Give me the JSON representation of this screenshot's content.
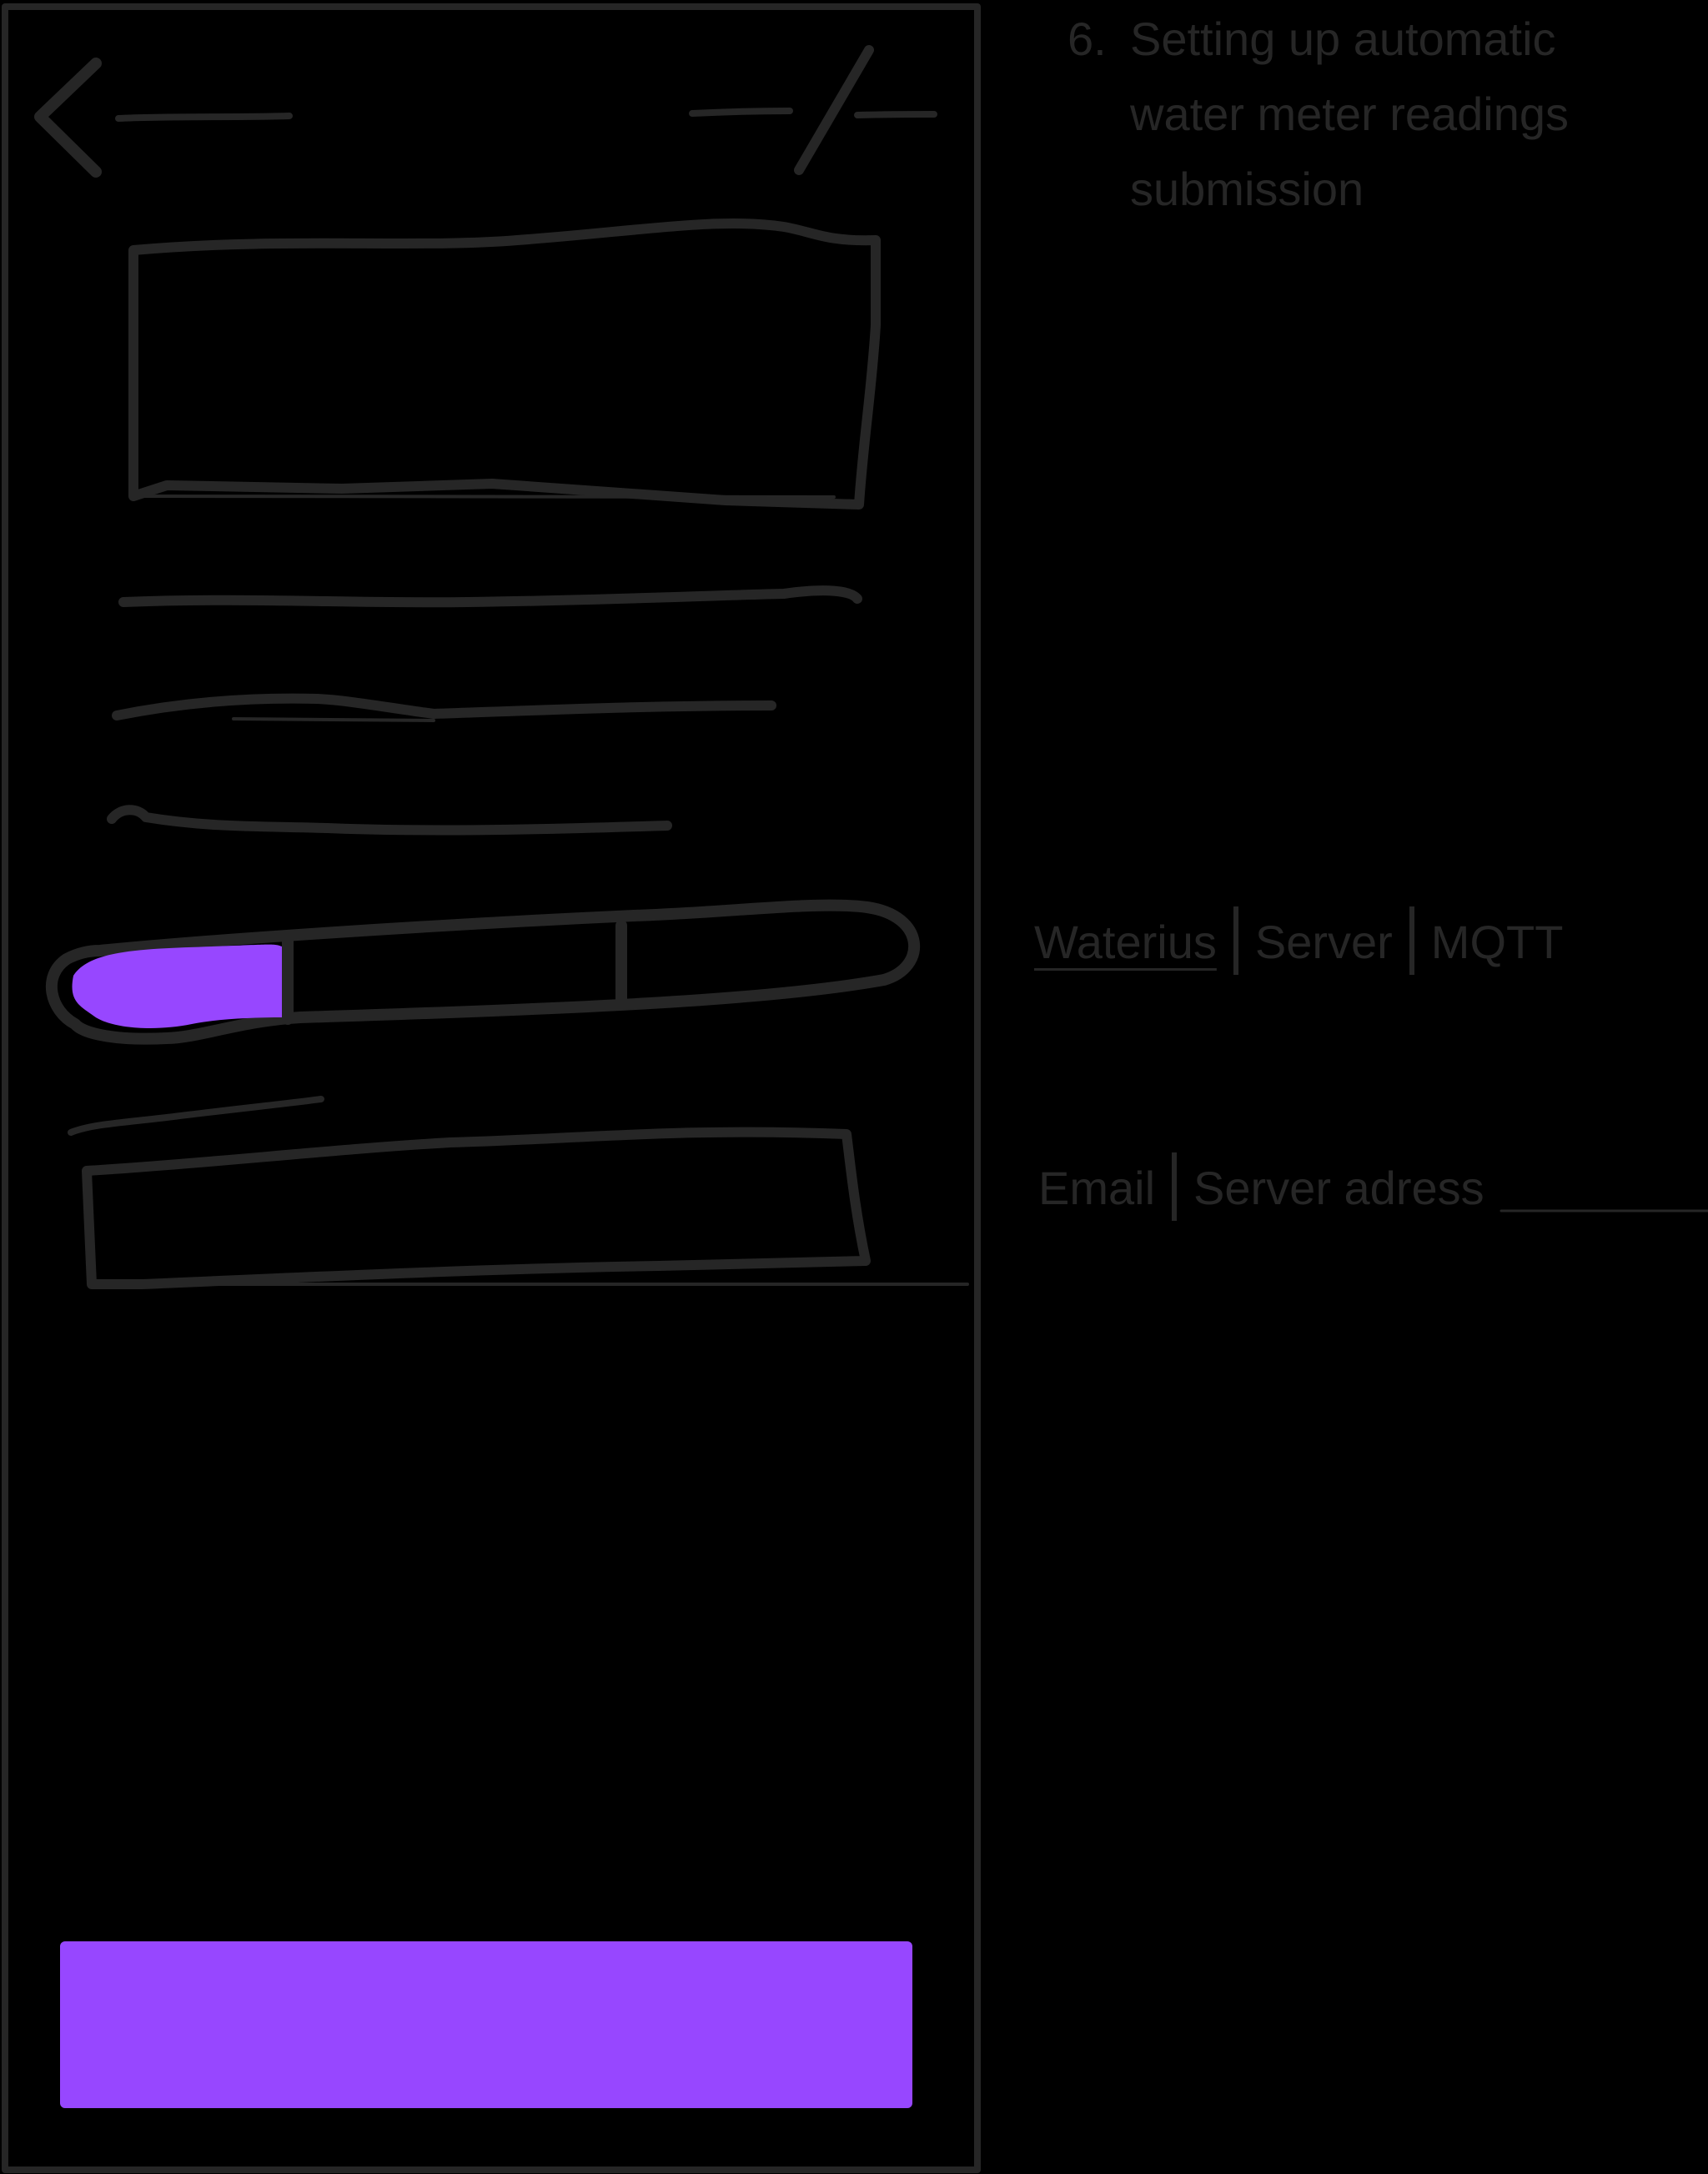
{
  "step": {
    "number": "6.",
    "title_lines": [
      "Setting up automatic",
      "water meter readings",
      "submission"
    ]
  },
  "source_options": {
    "items": [
      "Waterius",
      "Server",
      "MQTT"
    ],
    "selected": "Waterius"
  },
  "delivery_options": {
    "items": [
      "Email",
      "Server adress"
    ]
  },
  "colors": {
    "background": "#000000",
    "ink": "#262626",
    "accent": "#9747ff"
  }
}
